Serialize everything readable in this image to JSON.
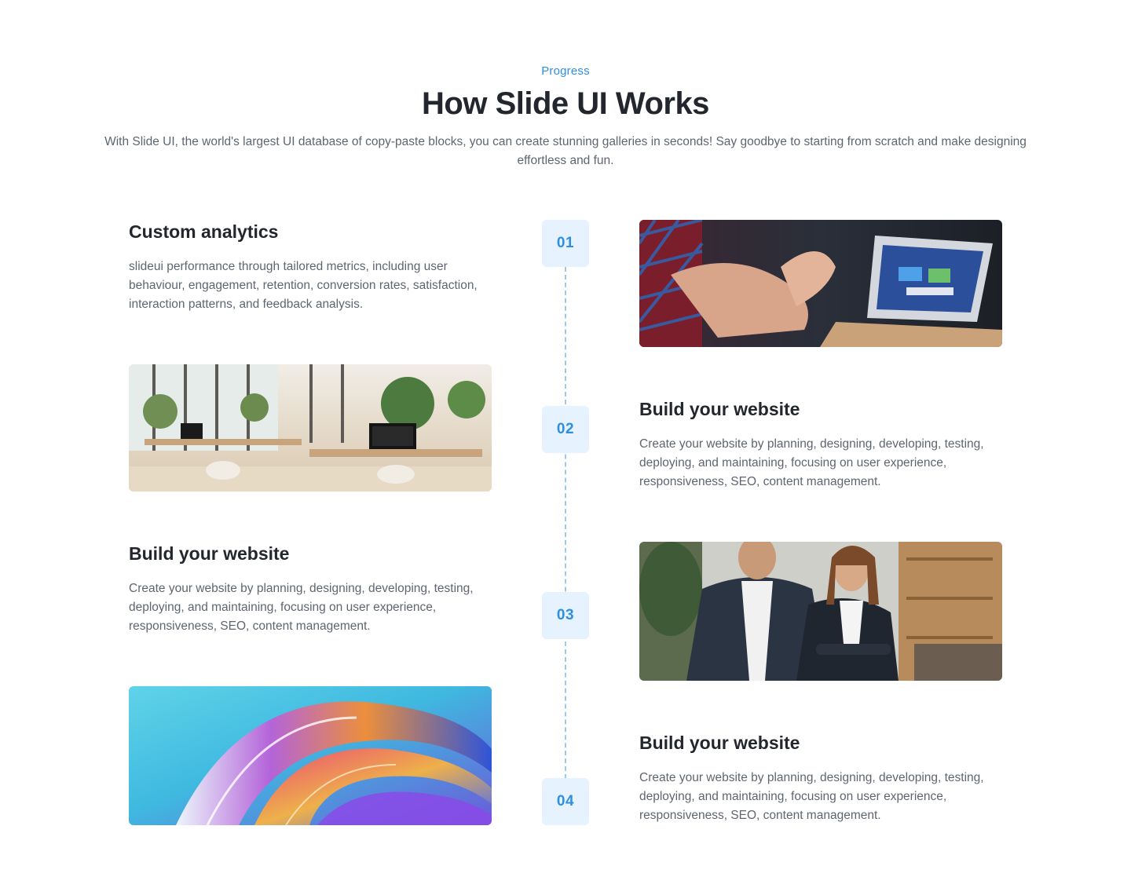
{
  "header": {
    "eyebrow": "Progress",
    "title": "How Slide UI Works",
    "intro": "With Slide UI, the world's largest UI database of copy-paste blocks, you can create stunning galleries in seconds! Say goodbye to starting from scratch and make designing effortless and fun."
  },
  "steps": [
    {
      "number": "01",
      "title": "Custom analytics",
      "description": "slideui performance through tailored metrics, including user behaviour, engagement, retention, conversion rates, satisfaction, interaction patterns, and feedback analysis.",
      "image": "laptop-hands-photo"
    },
    {
      "number": "02",
      "title": "Build your website",
      "description": "Create your website by planning, designing, developing, testing, deploying, and maintaining, focusing on user experience, responsiveness, SEO, content management.",
      "image": "office-interior-photo"
    },
    {
      "number": "03",
      "title": "Build your website",
      "description": "Create your website by planning, designing, developing, testing, deploying, and maintaining, focusing on user experience, responsiveness, SEO, content management.",
      "image": "business-team-photo"
    },
    {
      "number": "04",
      "title": "Build your website",
      "description": "Create your website by planning, designing, developing, testing, deploying, and maintaining, focusing on user experience, responsiveness, SEO, content management.",
      "image": "abstract-swirl-photo"
    }
  ],
  "colors": {
    "accent": "#2f8fe0",
    "badge_bg": "#e6f2fd",
    "heading": "#23272d",
    "body_text": "#5f6570",
    "timeline": "#9cc8f3"
  }
}
